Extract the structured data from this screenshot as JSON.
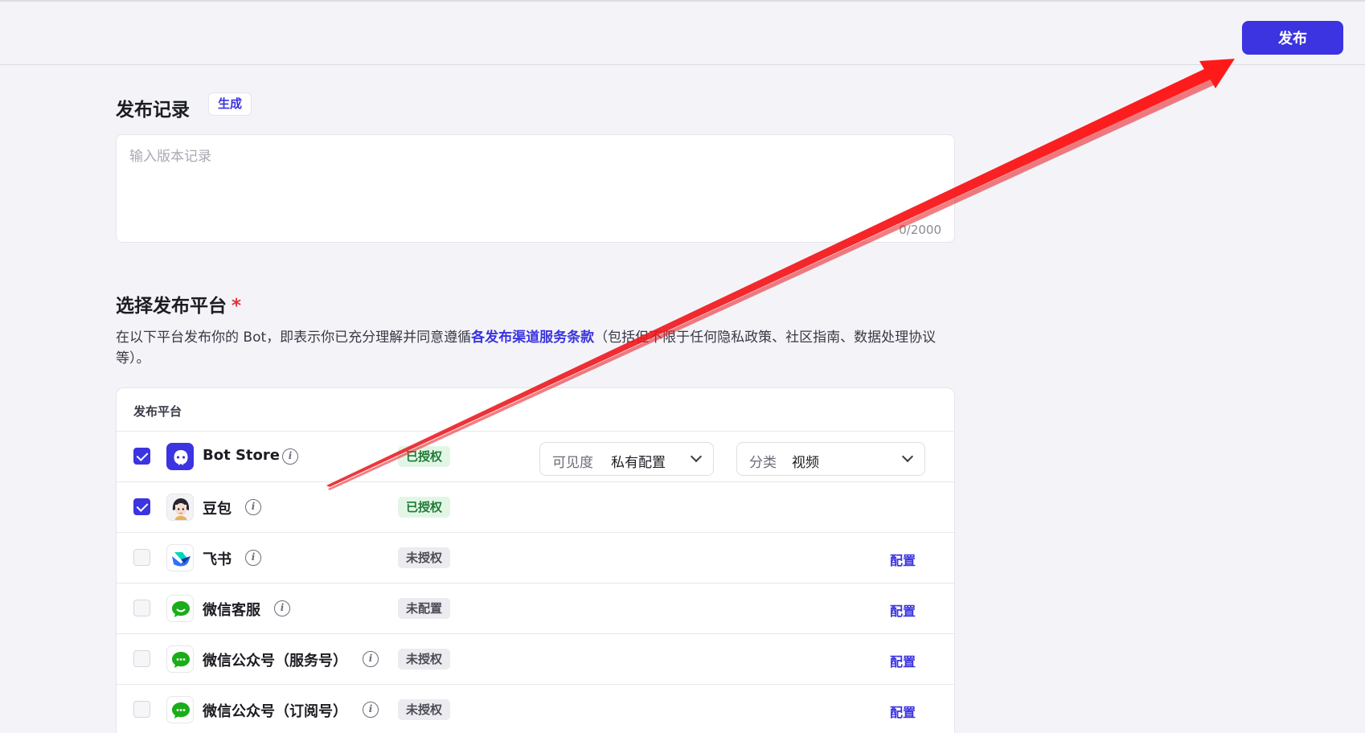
{
  "header": {
    "publish_label": "发布"
  },
  "record": {
    "title": "发布记录",
    "generate_label": "生成",
    "placeholder": "输入版本记录",
    "counter": "0/2000"
  },
  "platform_section": {
    "title": "选择发布平台",
    "required_mark": "*",
    "desc_before": "在以下平台发布你的 Bot，即表示你已充分理解并同意遵循",
    "desc_link": "各发布渠道服务条款",
    "desc_after": "（包括但不限于任何隐私政策、社区指南、数据处理协议等）。",
    "table_header": "发布平台"
  },
  "platforms": [
    {
      "name": "Bot Store",
      "checked": true,
      "status": "已授权",
      "status_type": "ok",
      "icon": "bot-store-icon",
      "visibility_label": "可见度",
      "visibility_value": "私有配置",
      "category_label": "分类",
      "category_value": "视频"
    },
    {
      "name": "豆包",
      "checked": true,
      "status": "已授权",
      "status_type": "ok",
      "icon": "doubao-avatar-icon"
    },
    {
      "name": "飞书",
      "checked": false,
      "status": "未授权",
      "status_type": "no",
      "icon": "feishu-icon",
      "action": "配置"
    },
    {
      "name": "微信客服",
      "checked": false,
      "status": "未配置",
      "status_type": "no",
      "icon": "wechat-icon",
      "action": "配置"
    },
    {
      "name": "微信公众号（服务号）",
      "checked": false,
      "status": "未授权",
      "status_type": "no",
      "icon": "wechat-icon",
      "action": "配置"
    },
    {
      "name": "微信公众号（订阅号）",
      "checked": false,
      "status": "未授权",
      "status_type": "no",
      "icon": "wechat-icon",
      "action": "配置"
    }
  ],
  "colors": {
    "accent": "#3b34e0",
    "annotation_arrow": "#e8141c",
    "authorized_bg": "#e3f6e6",
    "authorized_text": "#1f7a35"
  }
}
